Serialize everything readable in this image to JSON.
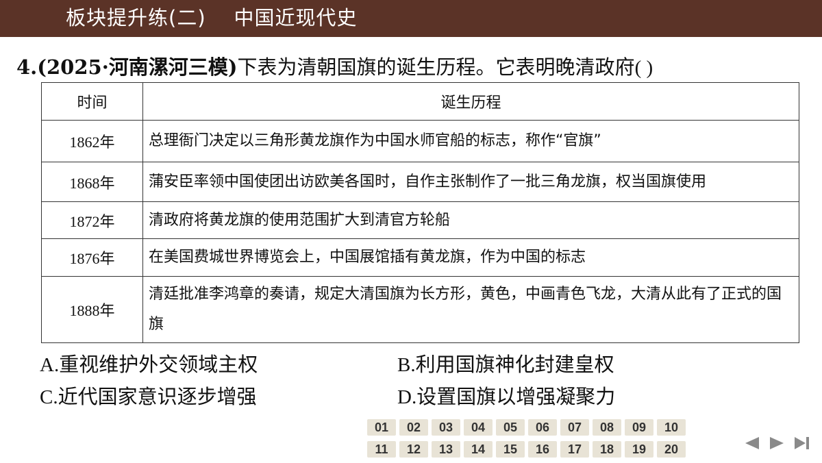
{
  "header": {
    "title": "板块提升练(二)    中国近现代史"
  },
  "question": {
    "number": "4.",
    "source": "(2025·河南漯河三模)",
    "text": "下表为清朝国旗的诞生历程。它表明晚清政府",
    "blank": "(        )"
  },
  "table": {
    "headers": [
      "时间",
      "诞生历程"
    ],
    "rows": [
      {
        "year": "1862",
        "unit": "年",
        "text": "总理衙门决定以三角形黄龙旗作为中国水师官船的标志，称作“官旗”"
      },
      {
        "year": "1868",
        "unit": "年",
        "text": "蒲安臣率领中国使团出访欧美各国时，自作主张制作了一批三角龙旗，权当国旗使用"
      },
      {
        "year": "1872",
        "unit": "年",
        "text": "清政府将黄龙旗的使用范围扩大到清官方轮船"
      },
      {
        "year": "1876",
        "unit": "年",
        "text": "在美国费城世界博览会上，中国展馆插有黄龙旗，作为中国的标志"
      },
      {
        "year": "1888",
        "unit": "年",
        "text": "清廷批准李鸿章的奏请，规定大清国旗为长方形，黄色，中画青色飞龙，大清从此有了正式的国旗"
      }
    ]
  },
  "options": [
    {
      "letter": "A.",
      "text": "重视维护外交领域主权"
    },
    {
      "letter": "B.",
      "text": "利用国旗神化封建皇权"
    },
    {
      "letter": "C.",
      "text": "近代国家意识逐步增强"
    },
    {
      "letter": "D.",
      "text": "设置国旗以增强凝聚力"
    }
  ],
  "pagination": {
    "pages": [
      "01",
      "02",
      "03",
      "04",
      "05",
      "06",
      "07",
      "08",
      "09",
      "10",
      "11",
      "12",
      "13",
      "14",
      "15",
      "16",
      "17",
      "18",
      "19",
      "20"
    ]
  },
  "navigation": {
    "prev_icon": "prev-arrow-icon",
    "next_icon": "next-arrow-icon",
    "last_icon": "last-page-icon"
  },
  "colors": {
    "header_bg": "#5b3327",
    "page_button_bg": "#e8e3d6",
    "nav_arrow": "#8a8a8a"
  }
}
